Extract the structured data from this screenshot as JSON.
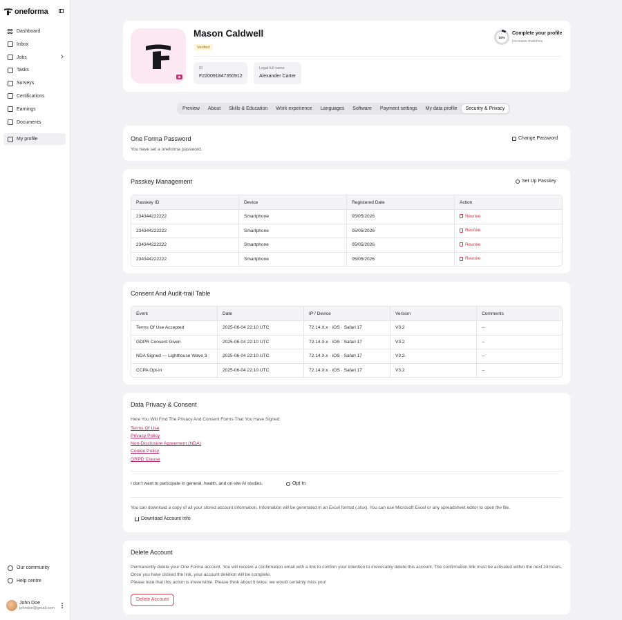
{
  "app": {
    "name": "oneforma"
  },
  "sidebar": {
    "items": [
      {
        "label": "Dashboard",
        "icon": "dashboard-grid-icon"
      },
      {
        "label": "Inbox",
        "icon": "inbox-icon"
      },
      {
        "label": "Jobs",
        "icon": "briefcase-icon"
      },
      {
        "label": "Tasks",
        "icon": "tasks-icon"
      },
      {
        "label": "Surveys",
        "icon": "survey-icon"
      },
      {
        "label": "Certifications",
        "icon": "certificate-icon"
      },
      {
        "label": "Earnings",
        "icon": "earnings-icon"
      },
      {
        "label": "Documents",
        "icon": "document-icon"
      },
      {
        "label": "My profile",
        "icon": "profile-icon"
      }
    ],
    "bottom": [
      {
        "label": "Our community",
        "icon": "globe-icon"
      },
      {
        "label": "Help centre",
        "icon": "help-icon"
      }
    ],
    "user": {
      "name": "John Doe",
      "email": "johndoe@gmail.com"
    }
  },
  "profile": {
    "name": "Mason Caldwell",
    "badge": "Verified",
    "id_label": "ID",
    "id_value": "F220091847350912",
    "legal_label": "Legal full name",
    "legal_value": "Alexander Carter",
    "progress_percent": 10,
    "progress_text": "10%",
    "complete_title": "Complete your profile",
    "complete_sub": "Increase matches",
    "accent_color": "#c7346f"
  },
  "tabs": [
    "Preview",
    "About",
    "Skills & Education",
    "Work experience",
    "Languages",
    "Software",
    "Payment settings",
    "My data profile",
    "Security & Privacy"
  ],
  "password": {
    "title": "One Forma Password",
    "text": "You have set a oneforma password.",
    "button": "Change Password"
  },
  "passkey": {
    "title": "Passkey Management",
    "button": "Set Up Passkey",
    "columns": [
      "Passkey ID",
      "Device",
      "Registered Date",
      "Action"
    ],
    "rows": [
      {
        "id": "234344222222",
        "device": "Smartphone",
        "date": "05/05/2026",
        "action": "Revoke"
      },
      {
        "id": "234344222222",
        "device": "Smartphone",
        "date": "05/05/2026",
        "action": "Revoke"
      },
      {
        "id": "234344222222",
        "device": "Smartphone",
        "date": "05/05/2026",
        "action": "Revoke"
      },
      {
        "id": "234344222222",
        "device": "Smartphone",
        "date": "05/05/2026",
        "action": "Revoke"
      }
    ]
  },
  "consent": {
    "title": "Consent And Audit-trail Table",
    "columns": [
      "Event",
      "Date",
      "IP / Device",
      "Version",
      "Comments"
    ],
    "rows": [
      {
        "event": "Terms Of Use Accepted",
        "date": "2025-06-04 22:10 UTC",
        "ip": "72.14.X.x · iOS · Safari 17",
        "version": "V3.2",
        "comments": "--"
      },
      {
        "event": "GDPR Consent Given",
        "date": "2025-06-04 22:10 UTC",
        "ip": "72.14.X.x · iOS · Safari 17",
        "version": "V3.2",
        "comments": "--"
      },
      {
        "event": "NDA Signed — Lighthouse Wave 3",
        "date": "2025-06-04 22:10 UTC",
        "ip": "72.14.X.x · iOS · Safari 17",
        "version": "V3.2",
        "comments": "--"
      },
      {
        "event": "CCPA Opt-in",
        "date": "2025-06-04 22:10 UTC",
        "ip": "72.14.X.x · iOS · Safari 17",
        "version": "V3.2",
        "comments": "--"
      }
    ]
  },
  "privacy": {
    "title": "Data Privacy & Consent",
    "intro": "Here You Will Find The Privacy And Consent Forms That You Have Signed:",
    "links": [
      "Terms Of Use",
      "Privacy Policy",
      "Non-Disclosure Agreement (NDA)",
      "Cookie Policy",
      "GRPD Clause"
    ],
    "ai_text": "I don't want to participate in general, health, and on-site AI studies.",
    "opt_in": "Opt In",
    "download_text": "You can download a copy of all your stored account information. Information will be generated in an Excel format (.xlsx). You can use Microsoft Excel or any spreadsheet editor to open the file.",
    "download_button": "Download Account Info"
  },
  "delete": {
    "title": "Delete Account",
    "text1": "Permanently delete your One Forma account. You will receive a confirmation email with a link to confirm your intention to irrevocably delete this account. The confirmation link must be activated within the next 24 hours. Once you have clicked the link, your account deletion will be complete.",
    "text2": "Please note that this action is irreversible. Please think about it twice; we would certainly miss you!",
    "button": "Delete Account",
    "danger_color": "#d63a4b"
  }
}
